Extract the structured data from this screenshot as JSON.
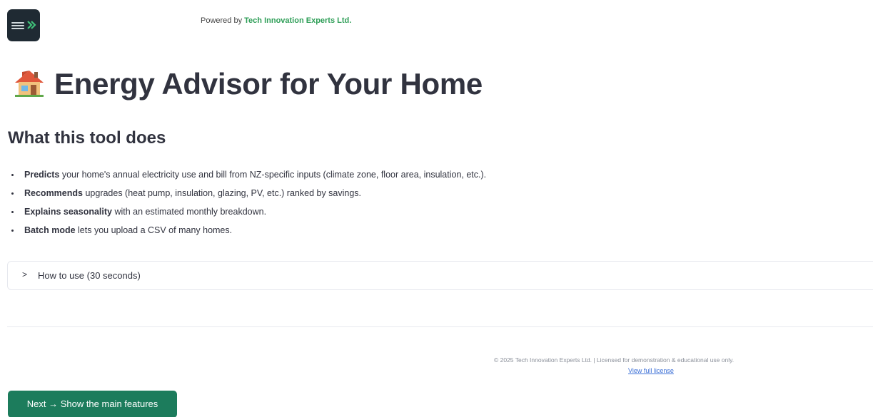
{
  "header": {
    "logo_icon": "company-logo",
    "powered_prefix": "Powered by",
    "powered_brand": "Tech Innovation Experts Ltd."
  },
  "title": {
    "icon": "house-icon",
    "text": "Energy Advisor for Your Home"
  },
  "section": {
    "heading": "What this tool does",
    "bullets": [
      {
        "bold": "Predicts",
        "rest": " your home's annual electricity use and bill from NZ-specific inputs (climate zone, floor area, insulation, etc.)."
      },
      {
        "bold": "Recommends",
        "rest": " upgrades (heat pump, insulation, glazing, PV, etc.) ranked by savings."
      },
      {
        "bold": "Explains seasonality",
        "rest": " with an estimated monthly breakdown."
      },
      {
        "bold": "Batch mode",
        "rest": " lets you upload a CSV of many homes."
      }
    ]
  },
  "expander": {
    "icon": "chevron-right-icon",
    "label": "How to use (30 seconds)"
  },
  "footer": {
    "license_text": "© 2025 Tech Innovation Experts Ltd. | Licensed for demonstration & educational use only.",
    "link_label": "View full license"
  },
  "next_button": {
    "label": "Next → Show the main features"
  },
  "colors": {
    "brand_green": "#2e9e57",
    "button_bg": "#1c7c5c",
    "link_blue": "#3b6fd6",
    "text": "#31333f"
  }
}
